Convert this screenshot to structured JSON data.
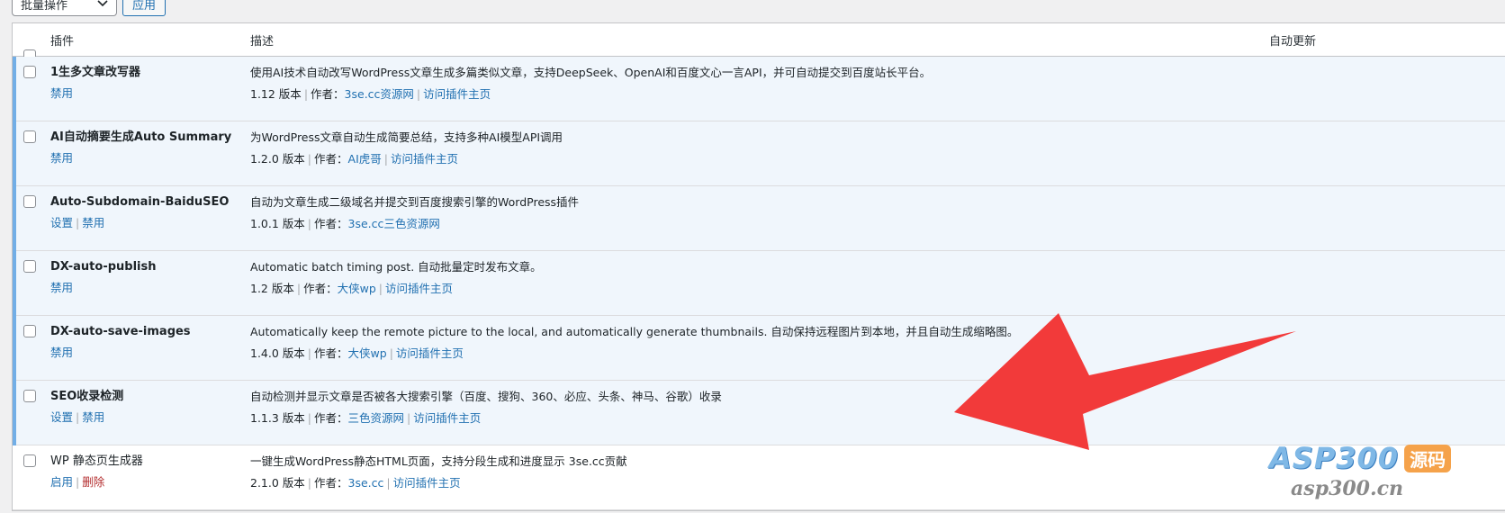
{
  "toolbar": {
    "bulk_action_label": "批量操作",
    "apply_label": "应用"
  },
  "table": {
    "columns": {
      "plugin": "插件",
      "description": "描述",
      "auto_update": "自动更新"
    },
    "rows": [
      {
        "name": "1生多文章改写器",
        "actions": [
          "禁用"
        ],
        "description": "使用AI技术自动改写WordPress文章生成多篇类似文章，支持DeepSeek、OpenAI和百度文心一言API，并可自动提交到百度站长平台。",
        "version": "1.12 版本",
        "author_prefix": "作者：",
        "author": "3se.cc资源网",
        "visit": "访问插件主页"
      },
      {
        "name": "AI自动摘要生成Auto Summary",
        "actions": [
          "禁用"
        ],
        "description": "为WordPress文章自动生成简要总结，支持多种AI模型API调用",
        "version": "1.2.0 版本",
        "author_prefix": "作者：",
        "author": "AI虎哥",
        "visit": "访问插件主页"
      },
      {
        "name": "Auto-Subdomain-BaiduSEO",
        "actions": [
          "设置",
          "禁用"
        ],
        "description": "自动为文章生成二级域名并提交到百度搜索引擎的WordPress插件",
        "version": "1.0.1 版本",
        "author_prefix": "作者：",
        "author": "3se.cc三色资源网",
        "visit": ""
      },
      {
        "name": "DX-auto-publish",
        "actions": [
          "禁用"
        ],
        "description": "Automatic batch timing post. 自动批量定时发布文章。",
        "version": "1.2 版本",
        "author_prefix": "作者：",
        "author": "大侠wp",
        "visit": "访问插件主页"
      },
      {
        "name": "DX-auto-save-images",
        "actions": [
          "禁用"
        ],
        "description": "Automatically keep the remote picture to the local, and automatically generate thumbnails. 自动保持远程图片到本地，并且自动生成缩略图。",
        "version": "1.4.0 版本",
        "author_prefix": "作者：",
        "author": "大侠wp",
        "visit": "访问插件主页"
      },
      {
        "name": "SEO收录检测",
        "actions": [
          "设置",
          "禁用"
        ],
        "description": "自动检测并显示文章是否被各大搜索引擎（百度、搜狗、360、必应、头条、神马、谷歌）收录",
        "version": "1.1.3 版本",
        "author_prefix": "作者：",
        "author": "三色资源网",
        "visit": "访问插件主页"
      },
      {
        "name": "WP 静态页生成器",
        "actions": [
          "启用",
          "删除"
        ],
        "description": "一键生成WordPress静态HTML页面，支持分段生成和进度显示 3se.cc贡献",
        "version": "2.1.0 版本",
        "author_prefix": "作者：",
        "author": "3se.cc",
        "visit": "访问插件主页"
      }
    ]
  },
  "watermark": {
    "brand": "ASP300",
    "badge": "源码",
    "url": "asp300.cn"
  },
  "colors": {
    "link": "#2271b1",
    "active_row_bg": "#f0f6fc",
    "active_accent": "#72aee6",
    "delete_link": "#b32d2e",
    "arrow": "#f23a3a"
  }
}
